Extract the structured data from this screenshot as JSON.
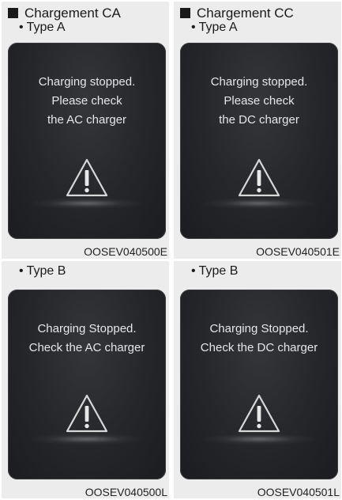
{
  "panels": [
    {
      "heading": "Chargement CA",
      "subheading": "Type A",
      "message_lines": [
        "Charging stopped.",
        "Please check",
        "the AC charger"
      ],
      "code": "OOSEV040500E"
    },
    {
      "heading": "Chargement CC",
      "subheading": "Type A",
      "message_lines": [
        "Charging stopped.",
        "Please check",
        "the DC charger"
      ],
      "code": "OOSEV040501E"
    },
    {
      "subheading": "Type B",
      "message_lines": [
        "Charging Stopped.",
        "Check the AC charger"
      ],
      "code": "OOSEV040500L"
    },
    {
      "subheading": "Type B",
      "message_lines": [
        "Charging Stopped.",
        "Check the DC charger"
      ],
      "code": "OOSEV040501L"
    }
  ],
  "bullet_glyph": "•",
  "icons": {
    "warning": "warning-triangle-icon",
    "section_marker": "square-bullet-icon"
  },
  "colors": {
    "screen": "#24262a",
    "screen_text": "#e6e6e6",
    "panel_bg": "#ececec"
  }
}
